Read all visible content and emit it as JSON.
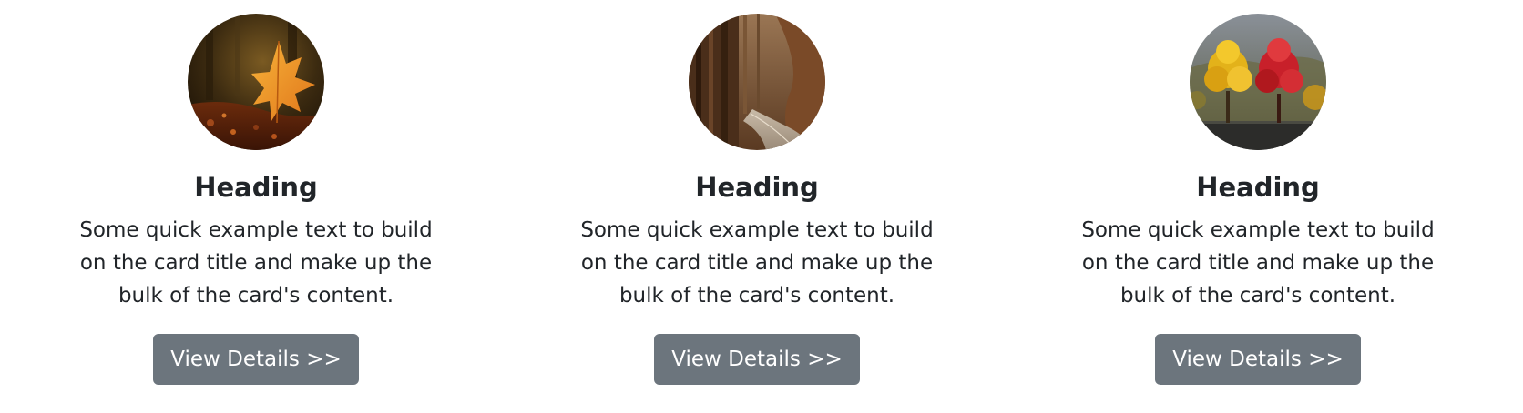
{
  "cards": [
    {
      "image_icon": "autumn-leaf-photo",
      "heading": "Heading",
      "text": "Some quick example text to build on the card title and make up the bulk of the card's content.",
      "button_label": "View Details >>"
    },
    {
      "image_icon": "forest-road-photo",
      "heading": "Heading",
      "text": "Some quick example text to build on the card title and make up the bulk of the card's content.",
      "button_label": "View Details >>"
    },
    {
      "image_icon": "autumn-trees-photo",
      "heading": "Heading",
      "text": "Some quick example text to build on the card title and make up the bulk of the card's content.",
      "button_label": "View Details >>"
    }
  ],
  "colors": {
    "button_bg": "#6c757d",
    "button_text": "#ffffff",
    "text": "#212529"
  }
}
